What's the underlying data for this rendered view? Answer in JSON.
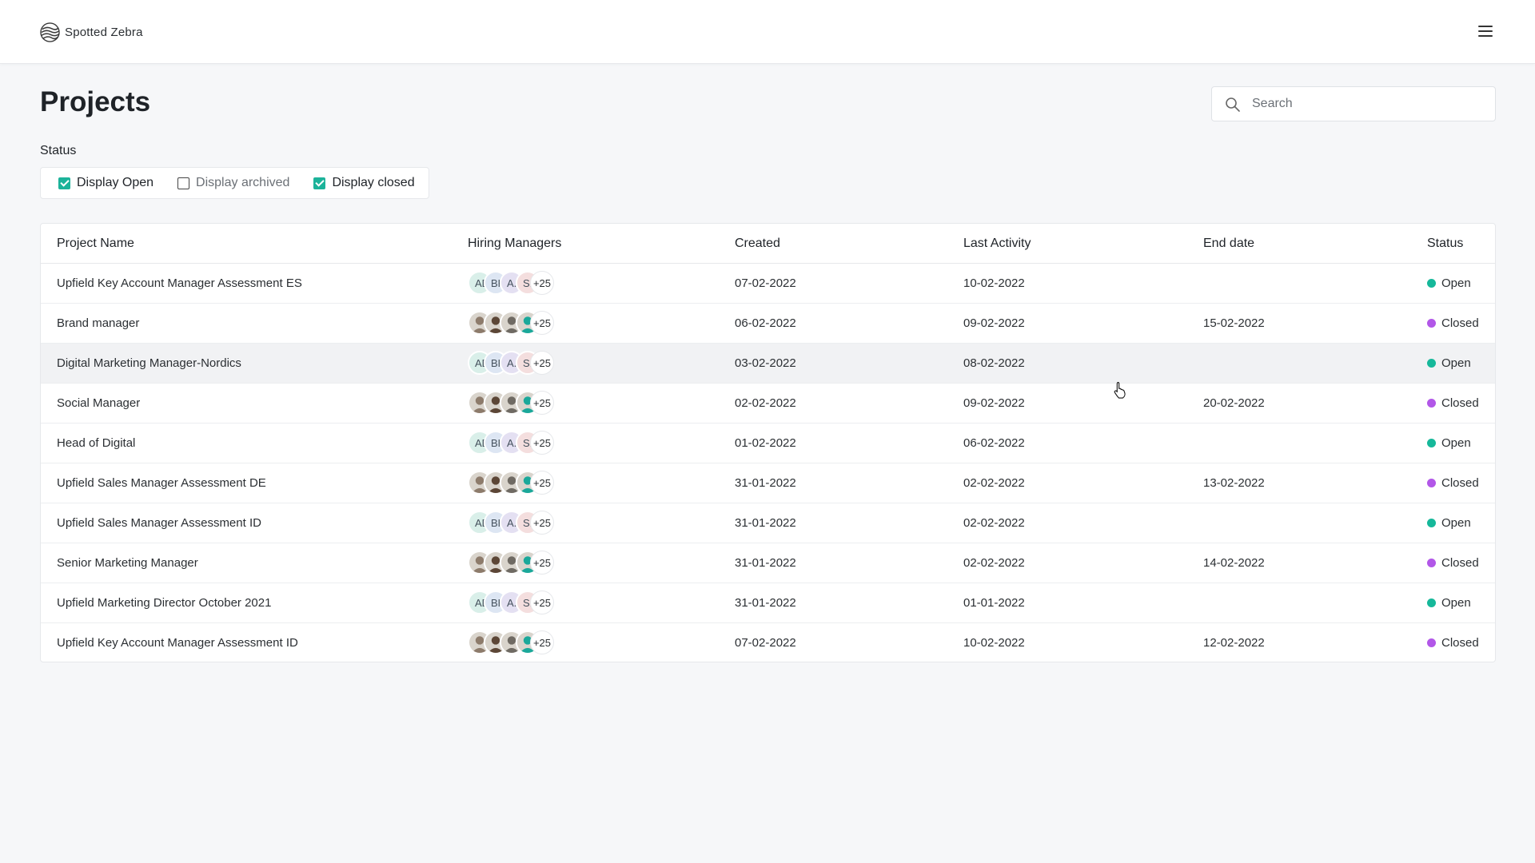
{
  "header": {
    "brand": "Spotted Zebra",
    "logo_icon": "zebra-stripes-logo",
    "menu_icon": "hamburger-icon"
  },
  "page": {
    "title": "Projects"
  },
  "search": {
    "placeholder": "Search",
    "value": ""
  },
  "filters": {
    "label": "Status",
    "items": [
      {
        "label": "Display Open",
        "checked": true
      },
      {
        "label": "Display archived",
        "checked": false
      },
      {
        "label": "Display closed",
        "checked": true
      }
    ]
  },
  "table": {
    "columns": [
      "Project Name",
      "Hiring Managers",
      "Created",
      "Last Activity",
      "End date",
      "Status"
    ],
    "rows": [
      {
        "name": "Upfield Key Account Manager Assessment ES",
        "managers": "initials",
        "created": "07-02-2022",
        "last_activity": "10-02-2022",
        "end_date": "",
        "status": "Open"
      },
      {
        "name": "Brand manager",
        "managers": "photos",
        "created": "06-02-2022",
        "last_activity": "09-02-2022",
        "end_date": "15-02-2022",
        "status": "Closed"
      },
      {
        "name": "Digital Marketing Manager-Nordics",
        "managers": "initials",
        "created": "03-02-2022",
        "last_activity": "08-02-2022",
        "end_date": "",
        "status": "Open"
      },
      {
        "name": "Social Manager",
        "managers": "photos",
        "created": "02-02-2022",
        "last_activity": "09-02-2022",
        "end_date": "20-02-2022",
        "status": "Closed"
      },
      {
        "name": "Head of Digital",
        "managers": "initials",
        "created": "01-02-2022",
        "last_activity": "06-02-2022",
        "end_date": "",
        "status": "Open"
      },
      {
        "name": "Upfield Sales Manager Assessment DE",
        "managers": "photos",
        "created": "31-01-2022",
        "last_activity": "02-02-2022",
        "end_date": "13-02-2022",
        "status": "Closed"
      },
      {
        "name": "Upfield Sales Manager Assessment ID",
        "managers": "initials",
        "created": "31-01-2022",
        "last_activity": "02-02-2022",
        "end_date": "",
        "status": "Open"
      },
      {
        "name": "Senior Marketing Manager",
        "managers": "photos",
        "created": "31-01-2022",
        "last_activity": "02-02-2022",
        "end_date": "14-02-2022",
        "status": "Closed"
      },
      {
        "name": "Upfield Marketing Director October 2021",
        "managers": "initials",
        "created": "31-01-2022",
        "last_activity": "01-01-2022",
        "end_date": "",
        "status": "Open"
      },
      {
        "name": "Upfield Key Account Manager Assessment ID",
        "managers": "photos",
        "created": "07-02-2022",
        "last_activity": "10-02-2022",
        "end_date": "12-02-2022",
        "status": "Closed"
      }
    ],
    "highlighted_row": 2
  },
  "managers": {
    "initials": [
      {
        "text": "AD",
        "bg": "#d9efe9"
      },
      {
        "text": "BH",
        "bg": "#dde6f3"
      },
      {
        "text": "A.",
        "bg": "#e4e0f2"
      },
      {
        "text": "SD",
        "bg": "#f4dede"
      }
    ],
    "photo_colors": [
      "#8d7b6b",
      "#5c4636",
      "#6f6a63",
      "#1aa89a"
    ],
    "more": "+25"
  },
  "status_colors": {
    "Open": "#16b89a",
    "Closed": "#b257e8"
  },
  "colors": {
    "accent": "#1cb39a",
    "background": "#f6f7f9"
  }
}
